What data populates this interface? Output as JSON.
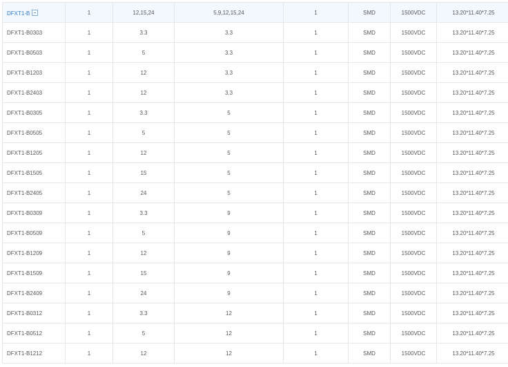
{
  "table": {
    "group_row": {
      "model": "DFXT1-B",
      "cells": [
        "1",
        "12,15,24",
        "5,9,12,15,24",
        "1",
        "SMD",
        "1500VDC",
        "13.20*11.40*7.25"
      ]
    },
    "rows": [
      {
        "model": "DFXT1-B0303",
        "cells": [
          "1",
          "3.3",
          "3.3",
          "1",
          "SMD",
          "1500VDC",
          "13.20*11.40*7.25"
        ]
      },
      {
        "model": "DFXT1-B0503",
        "cells": [
          "1",
          "5",
          "3.3",
          "1",
          "SMD",
          "1500VDC",
          "13.20*11.40*7.25"
        ]
      },
      {
        "model": "DFXT1-B1203",
        "cells": [
          "1",
          "12",
          "3.3",
          "1",
          "SMD",
          "1500VDC",
          "13.20*11.40*7.25"
        ]
      },
      {
        "model": "DFXT1-B2403",
        "cells": [
          "1",
          "12",
          "3.3",
          "1",
          "SMD",
          "1500VDC",
          "13.20*11.40*7.25"
        ]
      },
      {
        "model": "DFXT1-B0305",
        "cells": [
          "1",
          "3.3",
          "5",
          "1",
          "SMD",
          "1500VDC",
          "13.20*11.40*7.25"
        ]
      },
      {
        "model": "DFXT1-B0505",
        "cells": [
          "1",
          "5",
          "5",
          "1",
          "SMD",
          "1500VDC",
          "13.20*11.40*7.25"
        ]
      },
      {
        "model": "DFXT1-B1205",
        "cells": [
          "1",
          "12",
          "5",
          "1",
          "SMD",
          "1500VDC",
          "13.20*11.40*7.25"
        ]
      },
      {
        "model": "DFXT1-B1505",
        "cells": [
          "1",
          "15",
          "5",
          "1",
          "SMD",
          "1500VDC",
          "13.20*11.40*7.25"
        ]
      },
      {
        "model": "DFXT1-B2405",
        "cells": [
          "1",
          "24",
          "5",
          "1",
          "SMD",
          "1500VDC",
          "13.20*11.40*7.25"
        ]
      },
      {
        "model": "DFXT1-B0309",
        "cells": [
          "1",
          "3.3",
          "9",
          "1",
          "SMD",
          "1500VDC",
          "13.20*11.40*7.25"
        ]
      },
      {
        "model": "DFXT1-B0509",
        "cells": [
          "1",
          "5",
          "9",
          "1",
          "SMD",
          "1500VDC",
          "13.20*11.40*7.25"
        ]
      },
      {
        "model": "DFXT1-B1209",
        "cells": [
          "1",
          "12",
          "9",
          "1",
          "SMD",
          "1500VDC",
          "13.20*11.40*7.25"
        ]
      },
      {
        "model": "DFXT1-B1509",
        "cells": [
          "1",
          "15",
          "9",
          "1",
          "SMD",
          "1500VDC",
          "13.20*11.40*7.25"
        ]
      },
      {
        "model": "DFXT1-B2409",
        "cells": [
          "1",
          "24",
          "9",
          "1",
          "SMD",
          "1500VDC",
          "13.20*11.40*7.25"
        ]
      },
      {
        "model": "DFXT1-B0312",
        "cells": [
          "1",
          "3.3",
          "12",
          "1",
          "SMD",
          "1500VDC",
          "13.20*11.40*7.25"
        ]
      },
      {
        "model": "DFXT1-B0512",
        "cells": [
          "1",
          "5",
          "12",
          "1",
          "SMD",
          "1500VDC",
          "13.20*11.40*7.25"
        ]
      },
      {
        "model": "DFXT1-B1212",
        "cells": [
          "1",
          "12",
          "12",
          "1",
          "SMD",
          "1500VDC",
          "13.20*11.40*7.25"
        ]
      }
    ]
  },
  "colors": {
    "link": "#2f7bc4",
    "group_row_bg": "#f2f8fd",
    "border": "#e6e6e6",
    "text": "#555555"
  },
  "icons": {
    "collapse_toggle": "minus-square-icon"
  }
}
